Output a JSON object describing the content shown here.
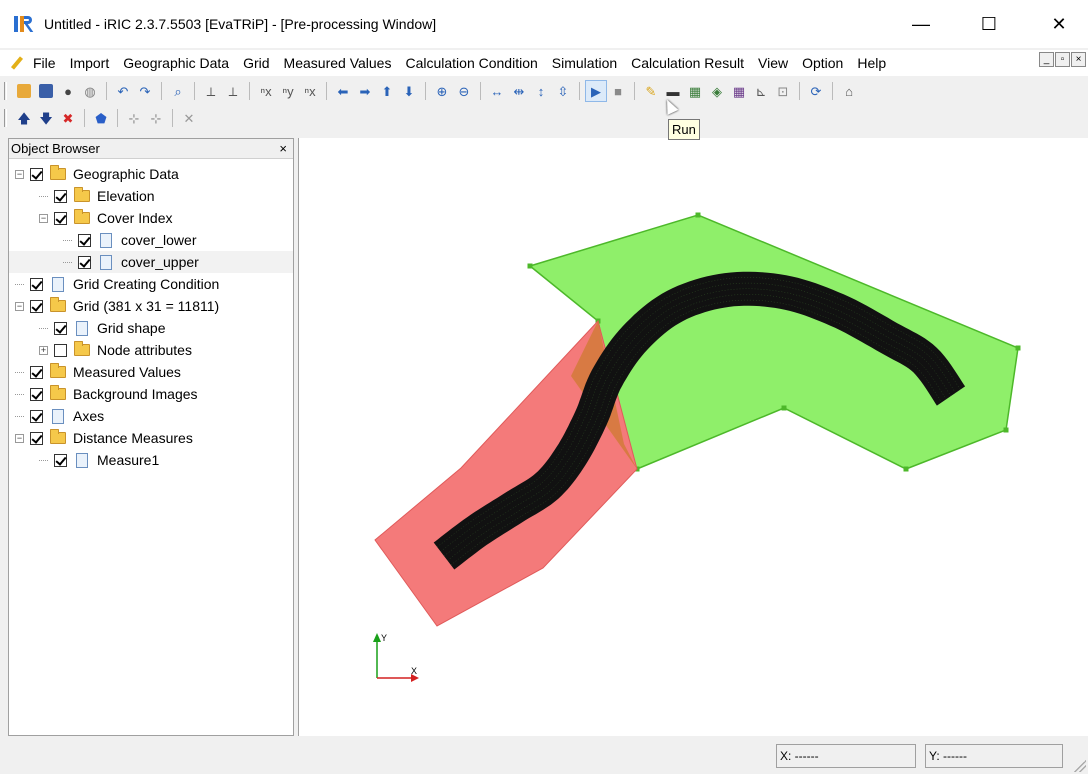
{
  "window": {
    "title": "Untitled - iRIC 2.3.7.5503 [EvaTRiP] - [Pre-processing Window]",
    "minimize_glyph": "—",
    "maximize_glyph": "☐",
    "close_glyph": "✕"
  },
  "menu": {
    "items": [
      "File",
      "Import",
      "Geographic Data",
      "Grid",
      "Measured Values",
      "Calculation Condition",
      "Simulation",
      "Calculation Result",
      "View",
      "Option",
      "Help"
    ],
    "mdi_controls": [
      "_",
      "▫",
      "×"
    ]
  },
  "toolbar1": {
    "groups": [
      [
        {
          "icon": "open-folder-icon",
          "glyph": "",
          "color": "#e8a93a"
        },
        {
          "icon": "save-icon",
          "glyph": "",
          "color": "#3a5fa8"
        },
        {
          "icon": "snapshot-icon",
          "glyph": "●",
          "color": "#444444"
        },
        {
          "icon": "globe-icon",
          "glyph": "◍",
          "color": "#808080"
        }
      ],
      [
        {
          "icon": "undo-icon",
          "glyph": "↶",
          "color": "#2a63b8"
        },
        {
          "icon": "redo-icon",
          "glyph": "↷",
          "color": "#2a63b8"
        }
      ],
      [
        {
          "icon": "zoom-icon",
          "glyph": "⌕",
          "color": "#2a63b8"
        }
      ],
      [
        {
          "icon": "axis-xy-icon",
          "glyph": "⟂",
          "color": "#555555"
        },
        {
          "icon": "axis-rotate-icon",
          "glyph": "⟂",
          "color": "#555555"
        }
      ],
      [
        {
          "icon": "view-x-icon",
          "glyph": "ⁿx",
          "color": "#555555"
        },
        {
          "icon": "view-y-icon",
          "glyph": "ⁿy",
          "color": "#555555"
        },
        {
          "icon": "view-z-icon",
          "glyph": "ⁿx",
          "color": "#555555"
        }
      ],
      [
        {
          "icon": "move-left-icon",
          "glyph": "⬅",
          "color": "#2a63b8"
        },
        {
          "icon": "move-right-icon",
          "glyph": "➡",
          "color": "#2a63b8"
        },
        {
          "icon": "move-up-icon",
          "glyph": "⬆",
          "color": "#2a63b8"
        },
        {
          "icon": "move-down-icon",
          "glyph": "⬇",
          "color": "#2a63b8"
        }
      ],
      [
        {
          "icon": "zoom-in-icon",
          "glyph": "⊕",
          "color": "#2a63b8"
        },
        {
          "icon": "zoom-out-icon",
          "glyph": "⊖",
          "color": "#2a63b8"
        }
      ],
      [
        {
          "icon": "expand-horizontal-icon",
          "glyph": "↔",
          "color": "#2a63b8"
        },
        {
          "icon": "shrink-horizontal-icon",
          "glyph": "⇹",
          "color": "#2a63b8"
        },
        {
          "icon": "expand-vertical-icon",
          "glyph": "↕",
          "color": "#2a63b8"
        },
        {
          "icon": "shrink-vertical-icon",
          "glyph": "⇳",
          "color": "#2a63b8"
        }
      ],
      [
        {
          "icon": "run-icon",
          "glyph": "▶",
          "color": "#2a63b8",
          "highlight": true
        },
        {
          "icon": "stop-icon",
          "glyph": "■",
          "color": "#8a8a8a"
        }
      ],
      [
        {
          "icon": "pencil-icon",
          "glyph": "✎",
          "color": "#d9a418"
        },
        {
          "icon": "console-icon",
          "glyph": "▬",
          "color": "#333333"
        },
        {
          "icon": "2d-view-icon",
          "glyph": "▦",
          "color": "#3a7d3a"
        },
        {
          "icon": "2d-bird-view-icon",
          "glyph": "◈",
          "color": "#3a7d3a"
        },
        {
          "icon": "3d-view-icon",
          "glyph": "▦",
          "color": "#6a3a8a"
        },
        {
          "icon": "graph-icon",
          "glyph": "⊾",
          "color": "#555555"
        },
        {
          "icon": "polyline-graph-icon",
          "glyph": "⊡",
          "color": "#888888"
        }
      ],
      [
        {
          "icon": "refresh-icon",
          "glyph": "⟳",
          "color": "#2a63b8"
        }
      ],
      [
        {
          "icon": "mouse-icon",
          "glyph": "⌂",
          "color": "#555555"
        }
      ]
    ]
  },
  "toolbar2": {
    "groups": [
      [
        {
          "icon": "arrow-up-icon",
          "glyph": "🡅",
          "color": "#1f3f8a"
        },
        {
          "icon": "arrow-down-icon",
          "glyph": "🡇",
          "color": "#1f3f8a"
        },
        {
          "icon": "delete-icon",
          "glyph": "✖",
          "color": "#d62828"
        }
      ],
      [
        {
          "icon": "polygon-icon",
          "glyph": "⬟",
          "color": "#2a5fc8"
        }
      ],
      [
        {
          "icon": "add-vertex-icon",
          "glyph": "⊹",
          "color": "#888888"
        },
        {
          "icon": "remove-vertex-icon",
          "glyph": "⊹",
          "color": "#888888"
        }
      ],
      [
        {
          "icon": "disabled-delete-icon",
          "glyph": "✕",
          "color": "#999999"
        }
      ]
    ]
  },
  "tooltip": {
    "text": "Run"
  },
  "object_browser": {
    "title": "Object Browser",
    "close_glyph": "×",
    "items": [
      {
        "label": "Geographic Data",
        "level": 0,
        "type": "folder",
        "checked": true,
        "expander": "-"
      },
      {
        "label": "Elevation",
        "level": 1,
        "type": "folder",
        "checked": true,
        "expander": ""
      },
      {
        "label": "Cover Index",
        "level": 1,
        "type": "folder",
        "checked": true,
        "expander": "-"
      },
      {
        "label": "cover_lower",
        "level": 2,
        "type": "doc",
        "checked": true,
        "expander": ""
      },
      {
        "label": "cover_upper",
        "level": 2,
        "type": "doc",
        "checked": true,
        "expander": "",
        "selected": true
      },
      {
        "label": "Grid Creating Condition",
        "level": 0,
        "type": "doc",
        "checked": true,
        "expander": ""
      },
      {
        "label": "Grid (381 x 31 = 11811)",
        "level": 0,
        "type": "folder",
        "checked": true,
        "expander": "-"
      },
      {
        "label": "Grid shape",
        "level": 1,
        "type": "doc",
        "checked": true,
        "expander": ""
      },
      {
        "label": "Node attributes",
        "level": 1,
        "type": "folder",
        "checked": false,
        "expander": "+"
      },
      {
        "label": "Measured Values",
        "level": 0,
        "type": "folder",
        "checked": true,
        "expander": ""
      },
      {
        "label": "Background Images",
        "level": 0,
        "type": "folder",
        "checked": true,
        "expander": ""
      },
      {
        "label": "Axes",
        "level": 0,
        "type": "doc",
        "checked": true,
        "expander": ""
      },
      {
        "label": "Distance Measures",
        "level": 0,
        "type": "folder",
        "checked": true,
        "expander": "-"
      },
      {
        "label": "Measure1",
        "level": 1,
        "type": "doc",
        "checked": true,
        "expander": ""
      }
    ]
  },
  "canvas": {
    "colors": {
      "green_fill": "#8fef6a",
      "green_stroke": "#4db82a",
      "red_fill": "#f47a7a",
      "overlap_fill": "#d27a3a",
      "grid": "#111111",
      "axis_x": "#d42020",
      "axis_y": "#19a019"
    },
    "axis_labels": {
      "x": "X",
      "y": "Y"
    }
  },
  "status": {
    "x": "X: ------",
    "y": "Y: ------"
  }
}
